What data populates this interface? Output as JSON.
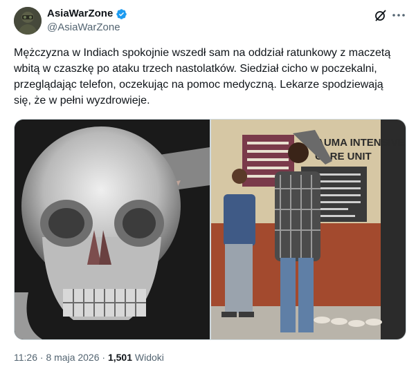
{
  "author": {
    "display_name": "AsiaWarZone",
    "handle": "@AsiaWarZone",
    "verified": true,
    "verified_color": "#1d9bf0"
  },
  "tweet": {
    "text": "Mężczyzna w Indiach spokojnie wszedł sam na oddział ratunkowy z maczetą wbitą w czaszkę po ataku trzech nastolatków. Siedział cicho w poczekalni, przeglądając telefon, oczekując na pomoc medyczną. Lekarze spodziewają się, że w pełni wyzdrowieje."
  },
  "media": {
    "left_image": "skull-xray-image",
    "right_image": "trauma-unit-photo",
    "sign_lines": [
      "TRAUMA INTENSIVE",
      "CARE UNIT"
    ]
  },
  "meta": {
    "time": "11:26",
    "date": "8 maja 2026",
    "separator": "·",
    "views_count": "1,501",
    "views_label": "Widoki"
  },
  "icons": {
    "grok": "grok-icon",
    "more": "more-icon",
    "verified": "verified-badge-icon"
  }
}
